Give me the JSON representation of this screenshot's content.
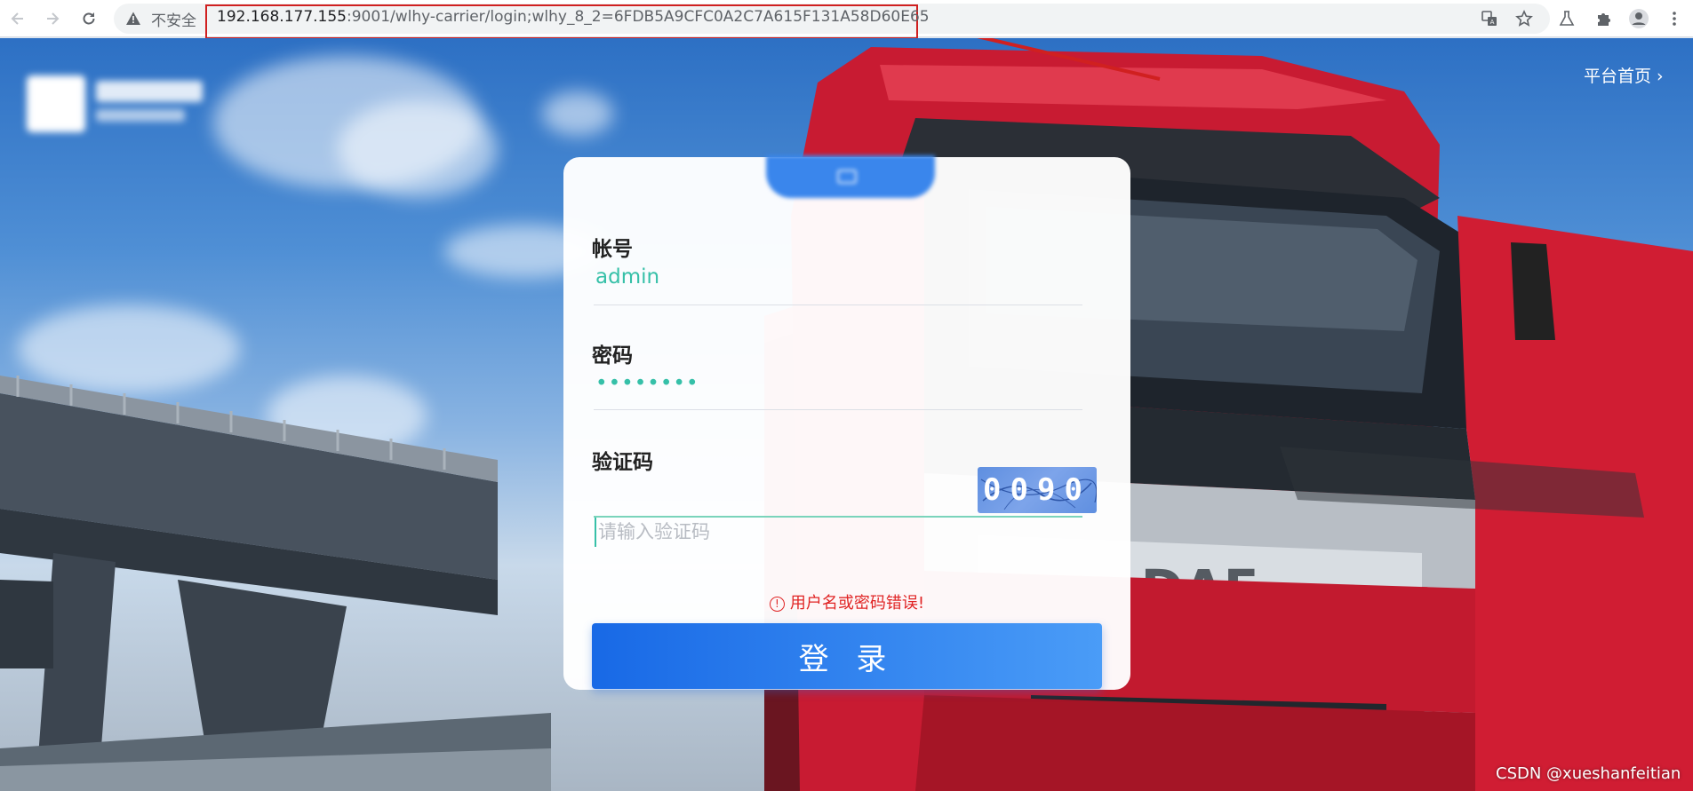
{
  "browser": {
    "security_label": "不安全",
    "url_host": "192.168.177.155",
    "url_rest": ":9001/wlhy-carrier/login;wlhy_8_2=6FDB5A9CFC0A2C7A615F131A58D60E65",
    "icons": [
      "back-icon",
      "forward-icon",
      "reload-icon",
      "warning-icon",
      "translate-icon",
      "star-icon",
      "labs-icon",
      "extensions-icon",
      "profile-icon",
      "menu-icon"
    ]
  },
  "header": {
    "home_link": "平台首页 ›"
  },
  "login": {
    "account_label": "帐号",
    "account_value": "admin",
    "password_label": "密码",
    "password_value": "••••••••",
    "captcha_label": "验证码",
    "captcha_placeholder": "请输入验证码",
    "captcha_code": "0090",
    "error_message": "用户名或密码错误!",
    "error_icon": "!",
    "login_button": "登 录"
  },
  "vehicle": {
    "brand_text": "DAF"
  },
  "watermark": "CSDN @xueshanfeitian",
  "colors": {
    "accent": "#36c0a8",
    "error": "#e02424",
    "button_start": "#1869e6",
    "button_end": "#4a9cf7",
    "annotation": "#d02020"
  }
}
